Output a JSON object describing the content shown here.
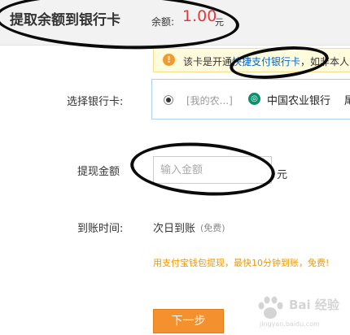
{
  "header": {
    "title": "提取余额到银行卡",
    "balance_label": "余额:",
    "balance_amount": "1.00",
    "balance_unit": "元"
  },
  "notice": {
    "text_before": "该卡是开通",
    "link_text": "快捷支付银行卡",
    "text_after": "，如非本人"
  },
  "bank_card": {
    "label": "选择银行卡:",
    "nickname": "[我的农...]",
    "bank_name": "中国农业银行",
    "tail": "尾"
  },
  "amount": {
    "label": "提现金额",
    "placeholder": "输入金额",
    "unit": "元"
  },
  "arrival": {
    "label": "到账时间:",
    "value": "次日到账",
    "fee": "(免费)"
  },
  "tip": "用支付宝钱包提现，最快10分钟到账，免费!",
  "next_button": "下一步",
  "watermark": {
    "brand": "Bai 经验",
    "url": "jingyan.baidu.com"
  },
  "colors": {
    "accent_orange": "#f5902e",
    "balance_red": "#e4393c",
    "link_blue": "#0066cc",
    "tip_orange": "#f39800",
    "bank_green": "#0a8f6a"
  }
}
